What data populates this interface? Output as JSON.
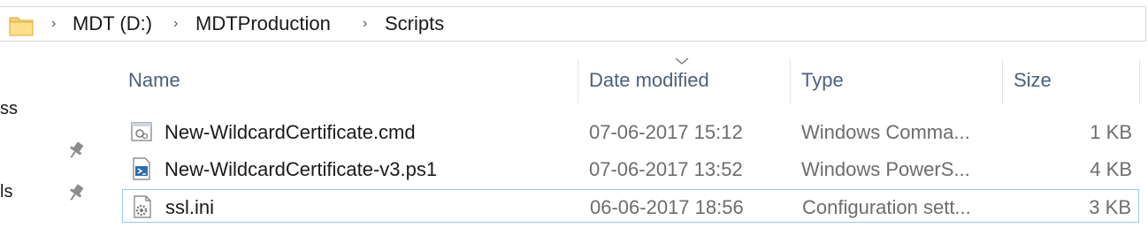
{
  "address_bar": {
    "breadcrumbs": [
      "MDT (D:)",
      "MDTProduction",
      "Scripts"
    ],
    "separator": "›"
  },
  "nav": {
    "fragments": [
      "ss",
      "ls"
    ]
  },
  "columns": {
    "name": "Name",
    "date": "Date modified",
    "type": "Type",
    "size": "Size"
  },
  "files": [
    {
      "name": "New-WildcardCertificate.cmd",
      "date": "07-06-2017 15:12",
      "type": "Windows Comma...",
      "size": "1 KB",
      "icon": "cmd-file-icon"
    },
    {
      "name": "New-WildcardCertificate-v3.ps1",
      "date": "07-06-2017 13:52",
      "type": "Windows PowerS...",
      "size": "4 KB",
      "icon": "powershell-file-icon"
    },
    {
      "name": "ssl.ini",
      "date": "06-06-2017 18:56",
      "type": "Configuration sett...",
      "size": "3 KB",
      "icon": "config-file-icon",
      "selected": true
    }
  ],
  "colors": {
    "header_text": "#4c607a",
    "selection_border": "#99c9ef",
    "secondary_text": "#6d6d6d"
  }
}
